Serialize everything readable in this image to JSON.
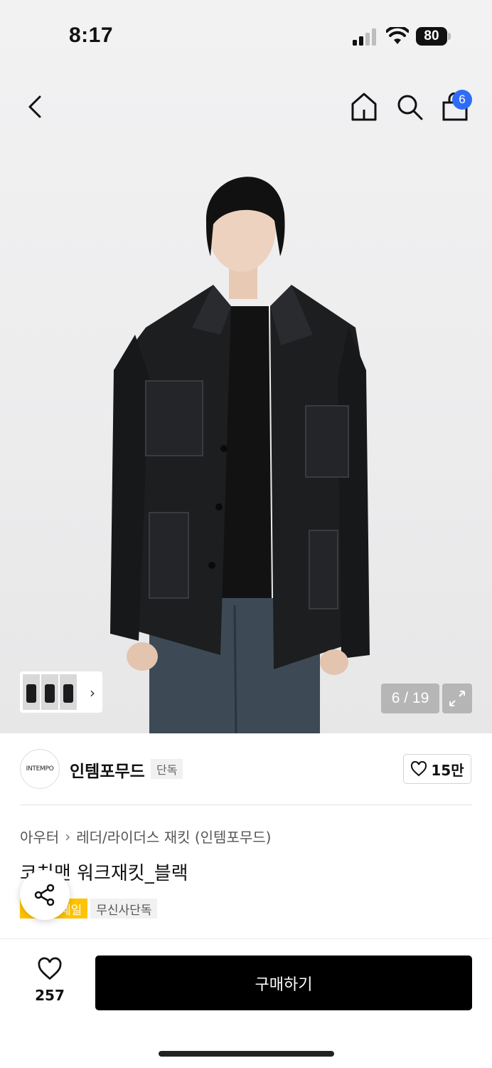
{
  "status_bar": {
    "time": "8:17",
    "battery": "80"
  },
  "nav": {
    "cart_count": "6"
  },
  "gallery": {
    "counter": "6 / 19"
  },
  "brand": {
    "logo_text": "INTEMPO",
    "name": "인템포무드",
    "tag": "단독",
    "likes": "15만"
  },
  "product": {
    "breadcrumb": [
      "아우터",
      "레더/라이더스 재킷 (인템포무드)"
    ],
    "title": "코치맨 워크재킷_블랙",
    "tags": [
      "세일",
      "무신사단독"
    ]
  },
  "bottom_bar": {
    "wish_count": "257",
    "buy_label": "구매하기"
  }
}
